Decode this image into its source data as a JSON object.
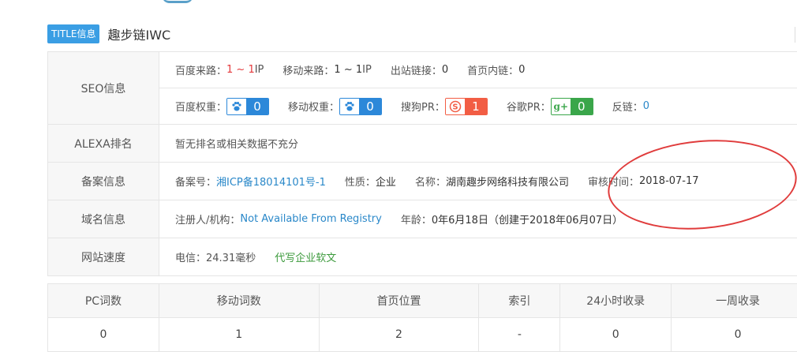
{
  "title": {
    "badge": "TITLE信息",
    "text": "趣步链IWC"
  },
  "seo": {
    "label": "SEO信息",
    "baidu_source_label": "百度来路：",
    "baidu_source_value": "1 ~ 1",
    "baidu_source_unit": " IP",
    "mobile_source_label": "移动来路：",
    "mobile_source_value": "1 ~ 1",
    "mobile_source_unit": " IP",
    "outlinks_label": "出站链接：",
    "outlinks_value": "0",
    "homepage_links_label": "首页内链：",
    "homepage_links_value": "0",
    "baidu_weight_label": "百度权重：",
    "baidu_weight_value": "0",
    "mobile_weight_label": "移动权重：",
    "mobile_weight_value": "0",
    "sogou_pr_label": "搜狗PR：",
    "sogou_pr_value": "1",
    "sogou_icon_text": "S",
    "google_pr_label": "谷歌PR：",
    "google_pr_value": "0",
    "google_icon_text": "g+",
    "backlinks_label": "反链：",
    "backlinks_value": "0"
  },
  "alexa": {
    "label": "ALEXA排名",
    "value": "暂无排名或相关数据不充分"
  },
  "icp": {
    "label": "备案信息",
    "number_label": "备案号：",
    "number_value": "湘ICP备18014101号-1",
    "nature_label": "性质：",
    "nature_value": "企业",
    "name_label": "名称：",
    "name_value": "湖南趣步网络科技有限公司",
    "review_label": "审核时间：",
    "review_value": "2018-07-17"
  },
  "domain": {
    "label": "域名信息",
    "registrant_label": "注册人/机构：",
    "registrant_value": "Not Available From Registry",
    "age_label": "年龄：",
    "age_value": "0年6月18日（创建于2018年06月07日）"
  },
  "speed": {
    "label": "网站速度",
    "value": "电信：24.31毫秒",
    "ad_link": "代写企业软文"
  },
  "words_table": {
    "headers": [
      "PC词数",
      "移动词数",
      "首页位置",
      "索引",
      "24小时收录",
      "一周收录"
    ],
    "values": [
      "0",
      "1",
      "2",
      "-",
      "0",
      "0"
    ]
  },
  "colors": {
    "accent": "#3a9ee4",
    "red": "#e4393c",
    "link": "#2a88c9",
    "annotation": "#e03c3c"
  },
  "icons": {
    "baidu": "paw-icon",
    "mobile": "paw-icon",
    "sogou": "sogou-s-icon",
    "google": "google-plus-icon"
  }
}
